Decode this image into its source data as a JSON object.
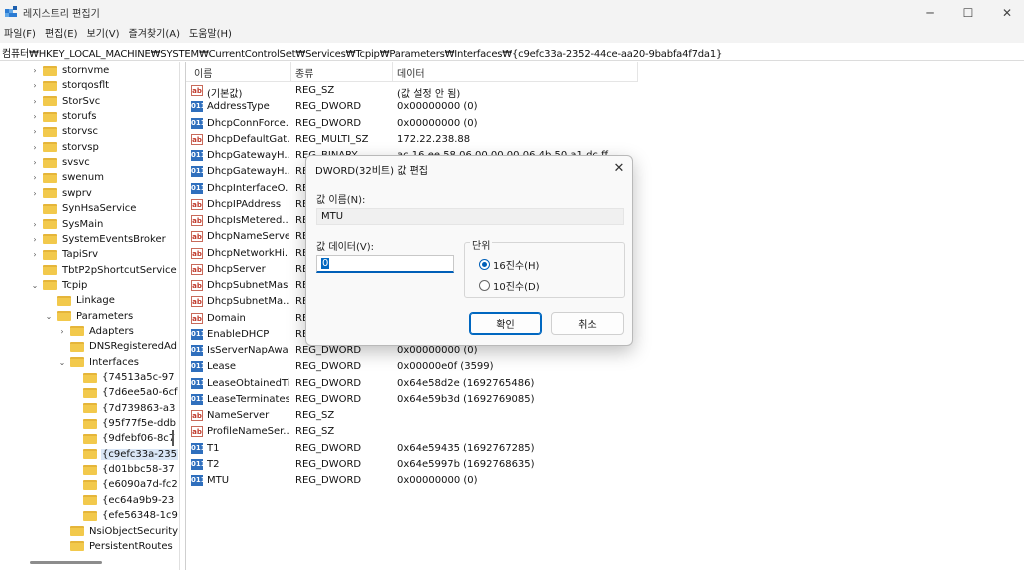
{
  "window": {
    "title": "레지스트리 편집기",
    "minimize_glyph": "─",
    "maximize_glyph": "☐",
    "close_glyph": "✕"
  },
  "menu": [
    "파일(F)",
    "편집(E)",
    "보기(V)",
    "즐겨찾기(A)",
    "도움말(H)"
  ],
  "address": "컴퓨터₩HKEY_LOCAL_MACHINE₩SYSTEM₩CurrentControlSet₩Services₩Tcpip₩Parameters₩Interfaces₩{c9efc33a-2352-44ce-aa20-9babfa4f7da1}",
  "tree": [
    {
      "label": "stornvme",
      "chevron": "›",
      "level": 0
    },
    {
      "label": "storqosflt",
      "chevron": "›",
      "level": 0
    },
    {
      "label": "StorSvc",
      "chevron": "›",
      "level": 0
    },
    {
      "label": "storufs",
      "chevron": "›",
      "level": 0
    },
    {
      "label": "storvsc",
      "chevron": "›",
      "level": 0
    },
    {
      "label": "storvsp",
      "chevron": "›",
      "level": 0
    },
    {
      "label": "svsvc",
      "chevron": "›",
      "level": 0
    },
    {
      "label": "swenum",
      "chevron": "›",
      "level": 0
    },
    {
      "label": "swprv",
      "chevron": "›",
      "level": 0
    },
    {
      "label": "SynHsaService",
      "chevron": "",
      "level": 0
    },
    {
      "label": "SysMain",
      "chevron": "›",
      "level": 0
    },
    {
      "label": "SystemEventsBroker",
      "chevron": "›",
      "level": 0
    },
    {
      "label": "TapiSrv",
      "chevron": "›",
      "level": 0
    },
    {
      "label": "TbtP2pShortcutService",
      "chevron": "",
      "level": 0
    },
    {
      "label": "Tcpip",
      "chevron": "⌄",
      "level": 0
    },
    {
      "label": "Linkage",
      "chevron": "",
      "level": 1
    },
    {
      "label": "Parameters",
      "chevron": "⌄",
      "level": 1
    },
    {
      "label": "Adapters",
      "chevron": "›",
      "level": 2
    },
    {
      "label": "DNSRegisteredAd",
      "chevron": "",
      "level": 2
    },
    {
      "label": "Interfaces",
      "chevron": "⌄",
      "level": 2
    },
    {
      "label": "{74513a5c-97",
      "chevron": "",
      "level": 3
    },
    {
      "label": "{7d6ee5a0-6cf",
      "chevron": "",
      "level": 3
    },
    {
      "label": "{7d739863-a3",
      "chevron": "",
      "level": 3
    },
    {
      "label": "{95f77f5e-ddb",
      "chevron": "",
      "level": 3
    },
    {
      "label": "{9dfebf06-8c7",
      "chevron": "",
      "level": 3
    },
    {
      "label": "{c9efc33a-235",
      "chevron": "",
      "level": 3,
      "selected": true
    },
    {
      "label": "{d01bbc58-37",
      "chevron": "",
      "level": 3
    },
    {
      "label": "{e6090a7d-fc2",
      "chevron": "",
      "level": 3
    },
    {
      "label": "{ec64a9b9-23",
      "chevron": "",
      "level": 3
    },
    {
      "label": "{efe56348-1c9",
      "chevron": "",
      "level": 3
    },
    {
      "label": "NsiObjectSecurity",
      "chevron": "",
      "level": 2
    },
    {
      "label": "PersistentRoutes",
      "chevron": "",
      "level": 2
    }
  ],
  "list": {
    "headers": {
      "name": "이름",
      "type": "종류",
      "data": "데이터"
    },
    "rows": [
      {
        "icon": "sz",
        "name": "(기본값)",
        "type": "REG_SZ",
        "data": "(값 설정 안 됨)"
      },
      {
        "icon": "bin",
        "name": "AddressType",
        "type": "REG_DWORD",
        "data": "0x00000000 (0)"
      },
      {
        "icon": "bin",
        "name": "DhcpConnForce...",
        "type": "REG_DWORD",
        "data": "0x00000000 (0)"
      },
      {
        "icon": "sz",
        "name": "DhcpDefaultGat...",
        "type": "REG_MULTI_SZ",
        "data": "172.22.238.88"
      },
      {
        "icon": "bin",
        "name": "DhcpGatewayH...",
        "type": "REG_BINARY",
        "data": "ac 16 ee 58 06 00 00 00 06 4b 50 a1 dc ff"
      },
      {
        "icon": "bin",
        "name": "DhcpGatewayH...",
        "type": "RE",
        "data": ""
      },
      {
        "icon": "bin",
        "name": "DhcpInterfaceO...",
        "type": "RE",
        "data": ""
      },
      {
        "icon": "sz",
        "name": "DhcpIPAddress",
        "type": "RE",
        "data": ""
      },
      {
        "icon": "sz",
        "name": "DhcpIsMetered...",
        "type": "RE",
        "data": ""
      },
      {
        "icon": "sz",
        "name": "DhcpNameServer",
        "type": "RE",
        "data": ""
      },
      {
        "icon": "sz",
        "name": "DhcpNetworkHi...",
        "type": "RE",
        "data": ""
      },
      {
        "icon": "sz",
        "name": "DhcpServer",
        "type": "RE",
        "data": ""
      },
      {
        "icon": "sz",
        "name": "DhcpSubnetMask",
        "type": "RE",
        "data": ""
      },
      {
        "icon": "sz",
        "name": "DhcpSubnetMa...",
        "type": "RE",
        "data": ""
      },
      {
        "icon": "sz",
        "name": "Domain",
        "type": "RE",
        "data": ""
      },
      {
        "icon": "bin",
        "name": "EnableDHCP",
        "type": "RE",
        "data": ""
      },
      {
        "icon": "bin",
        "name": "IsServerNapAware",
        "type": "REG_DWORD",
        "data": "0x00000000 (0)"
      },
      {
        "icon": "bin",
        "name": "Lease",
        "type": "REG_DWORD",
        "data": "0x00000e0f (3599)"
      },
      {
        "icon": "bin",
        "name": "LeaseObtainedTi...",
        "type": "REG_DWORD",
        "data": "0x64e58d2e (1692765486)"
      },
      {
        "icon": "bin",
        "name": "LeaseTerminates...",
        "type": "REG_DWORD",
        "data": "0x64e59b3d (1692769085)"
      },
      {
        "icon": "sz",
        "name": "NameServer",
        "type": "REG_SZ",
        "data": ""
      },
      {
        "icon": "sz",
        "name": "ProfileNameSer...",
        "type": "REG_SZ",
        "data": ""
      },
      {
        "icon": "bin",
        "name": "T1",
        "type": "REG_DWORD",
        "data": "0x64e59435 (1692767285)"
      },
      {
        "icon": "bin",
        "name": "T2",
        "type": "REG_DWORD",
        "data": "0x64e5997b (1692768635)"
      },
      {
        "icon": "bin",
        "name": "MTU",
        "type": "REG_DWORD",
        "data": "0x00000000 (0)"
      }
    ]
  },
  "dialog": {
    "title": "DWORD(32비트) 값 편집",
    "close_glyph": "✕",
    "value_name_label": "값 이름(N):",
    "value_name": "MTU",
    "value_data_label": "값 데이터(V):",
    "value_data": "0",
    "base_label": "단위",
    "hex_label": "16진수(H)",
    "dec_label": "10진수(D)",
    "selected_base": "hex",
    "ok_label": "확인",
    "cancel_label": "취소"
  },
  "colors": {
    "accent": "#005fb8",
    "folder": "#f2c94c",
    "selection": "#d9e6f6"
  }
}
